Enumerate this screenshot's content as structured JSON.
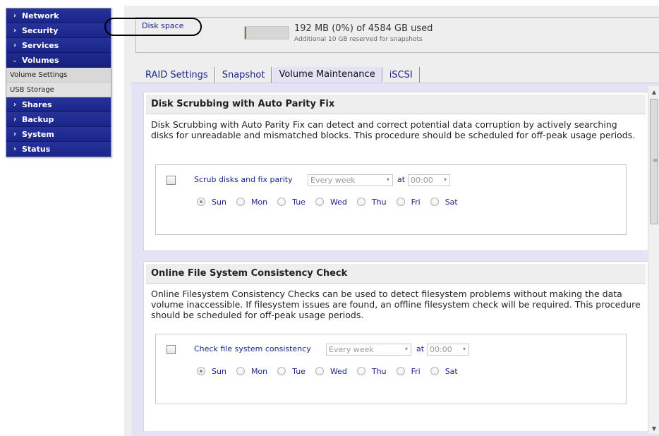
{
  "sidebar": {
    "items": [
      {
        "label": "Network",
        "chevron": "›"
      },
      {
        "label": "Security",
        "chevron": "›"
      },
      {
        "label": "Services",
        "chevron": "›"
      },
      {
        "label": "Volumes",
        "chevron": "⌄"
      },
      {
        "label": "Shares",
        "chevron": "›"
      },
      {
        "label": "Backup",
        "chevron": "›"
      },
      {
        "label": "System",
        "chevron": "›"
      },
      {
        "label": "Status",
        "chevron": "›"
      }
    ],
    "sub_items": [
      "Volume Settings",
      "USB Storage"
    ]
  },
  "disk": {
    "label": "Disk space",
    "used_text": "192 MB (0%) of 4584 GB used",
    "reserved_text": "Additional 10 GB reserved for snapshots",
    "usage_fraction": 0.0,
    "meter_color": "#18b018"
  },
  "tabs": [
    "RAID Settings",
    "Snapshot",
    "Volume Maintenance",
    "iSCSI"
  ],
  "active_tab": "Volume Maintenance",
  "sections": [
    {
      "title": "Disk Scrubbing with Auto Parity Fix",
      "description": "Disk Scrubbing with Auto Parity Fix can detect and correct potential data corruption by actively searching disks for unreadable and mismatched blocks. This procedure should be scheduled for off-peak usage periods.",
      "checkbox_label": "Scrub disks and fix parity",
      "checked": false,
      "frequency": "Every week",
      "at_label": "at",
      "time": "00:00",
      "days": [
        "Sun",
        "Mon",
        "Tue",
        "Wed",
        "Thu",
        "Fri",
        "Sat"
      ],
      "selected_day": "Sun"
    },
    {
      "title": "Online File System Consistency Check",
      "description": "Online Filesystem Consistency Checks can be used to detect filesystem problems without making the data volume inaccessible. If filesystem issues are found, an offline filesystem check will be required. This procedure should be scheduled for off-peak usage periods.",
      "checkbox_label": "Check file system consistency",
      "checked": false,
      "frequency": "Every week",
      "at_label": "at",
      "time": "00:00",
      "days": [
        "Sun",
        "Mon",
        "Tue",
        "Wed",
        "Thu",
        "Fri",
        "Sat"
      ],
      "selected_day": "Sun"
    }
  ],
  "icons": {
    "dropdown_arrow": "▾",
    "scroll_up": "▲",
    "scroll_down": "▼",
    "scroll_grip": "≡"
  },
  "colors": {
    "nav_bg": "#1a2588",
    "link_text": "#1a2588",
    "panel_bg": "#e3e3f5"
  }
}
